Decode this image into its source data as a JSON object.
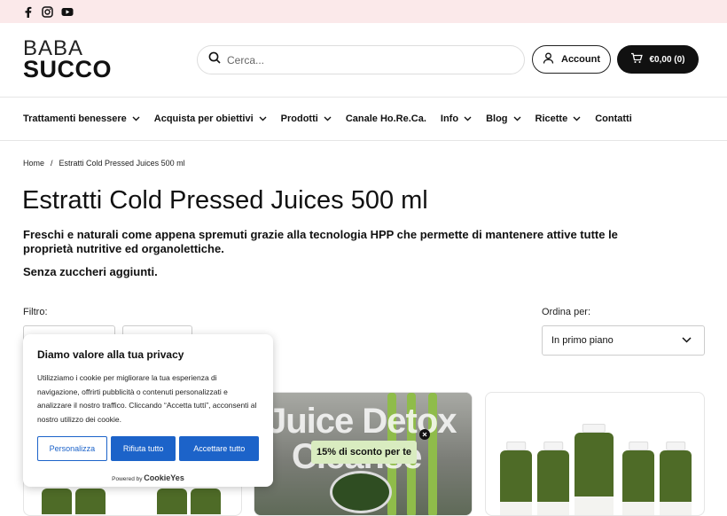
{
  "topbar": {
    "icons": [
      "facebook-icon",
      "instagram-icon",
      "youtube-icon"
    ]
  },
  "logo": {
    "line1": "BABA",
    "line2": "SUCCO"
  },
  "search": {
    "placeholder": "Cerca..."
  },
  "account": {
    "label": "Account"
  },
  "cart": {
    "label": "€0,00 (0)"
  },
  "nav": {
    "items": [
      {
        "label": "Trattamenti benessere",
        "dropdown": true
      },
      {
        "label": "Acquista per obiettivi",
        "dropdown": true
      },
      {
        "label": "Prodotti",
        "dropdown": true
      },
      {
        "label": "Canale Ho.Re.Ca.",
        "dropdown": false
      },
      {
        "label": "Info",
        "dropdown": true
      },
      {
        "label": "Blog",
        "dropdown": true
      },
      {
        "label": "Ricette",
        "dropdown": true
      },
      {
        "label": "Contatti",
        "dropdown": false
      }
    ]
  },
  "breadcrumb": {
    "home": "Home",
    "separator": "/",
    "current": "Estratti Cold Pressed Juices 500 ml"
  },
  "page": {
    "title": "Estratti Cold Pressed Juices 500 ml",
    "description": "Freschi e naturali come appena spremuti grazie alla tecnologia HPP che permette di mantenere attive tutte le proprietà nutritive ed organolettiche.",
    "description2": "Senza zuccheri aggiunti."
  },
  "filter": {
    "label": "Filtro:"
  },
  "sort": {
    "label": "Ordina per:",
    "selected": "In primo piano"
  },
  "promo": {
    "image_text_line1": "Juice Detox",
    "image_text_line2": "Cleanse",
    "badge": "15% di sconto per te"
  },
  "cookie": {
    "title": "Diamo valore alla tua privacy",
    "text": "Utilizziamo i cookie per migliorare la tua esperienza di navigazione, offrirti pubblicità o contenuti personalizzati e analizzare il nostro traffico. Cliccando “Accetta tutti”, acconsenti al nostro utilizzo dei cookie.",
    "btn_customize": "Personalizza",
    "btn_reject": "Rifiuta tutto",
    "btn_accept": "Accettare tutto",
    "powered_prefix": "Powered by",
    "powered_brand": "CookieYes"
  },
  "colors": {
    "topbar_bg": "#fbe9ea",
    "cookie_blue": "#1c63c9",
    "badge_green": "#d9ecc0",
    "dark": "#111111"
  }
}
